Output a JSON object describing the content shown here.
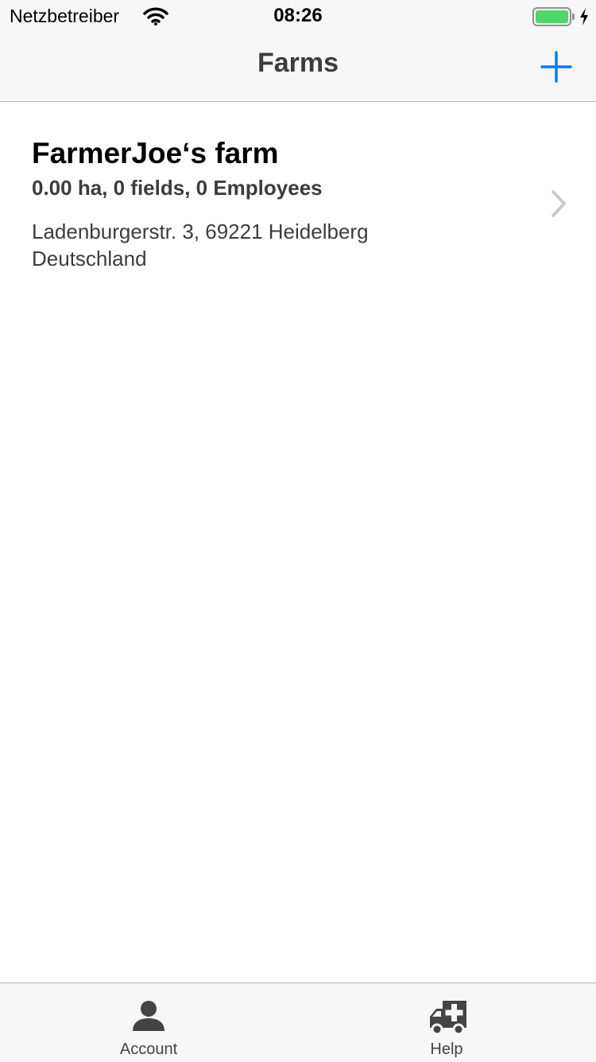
{
  "status_bar": {
    "carrier": "Netzbetreiber",
    "time": "08:26",
    "battery_color": "#4cd964"
  },
  "nav": {
    "title": "Farms",
    "add_icon": "plus-icon",
    "accent_color": "#007aff"
  },
  "farms": [
    {
      "name": "FarmerJoe‘s farm",
      "stats": "0.00 ha, 0 fields, 0 Employees",
      "address": "Ladenburgerstr. 3, 69221 Heidelberg",
      "country": "Deutschland"
    }
  ],
  "tabs": [
    {
      "label": "Account",
      "icon": "person-icon"
    },
    {
      "label": "Help",
      "icon": "ambulance-icon"
    }
  ]
}
